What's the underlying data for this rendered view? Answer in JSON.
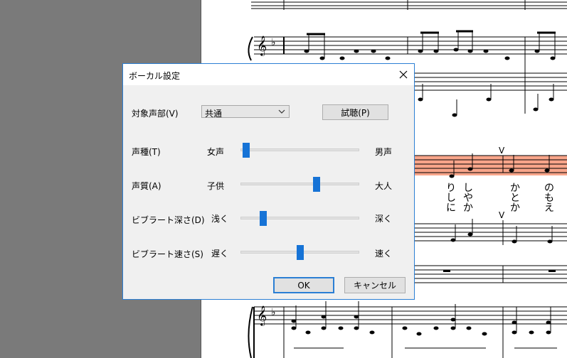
{
  "dialog": {
    "title": "ボーカル設定",
    "close_icon": "close-icon",
    "target_part": {
      "label": "対象声部(V)",
      "value": "共通"
    },
    "preview_button": "試聴(P)",
    "sliders": [
      {
        "label": "声種(T)",
        "min": "女声",
        "max": "男声",
        "value": 0.02
      },
      {
        "label": "声質(A)",
        "min": "子供",
        "max": "大人",
        "value": 0.65
      },
      {
        "label": "ビブラート深さ(D)",
        "min": "浅く",
        "max": "深く",
        "value": 0.17
      },
      {
        "label": "ビブラート速さ(S)",
        "min": "遅く",
        "max": "速く",
        "value": 0.5
      }
    ],
    "ok_button": "OK",
    "cancel_button": "キャンセル"
  },
  "score": {
    "lyrics": [
      "り",
      "し",
      "に",
      "し",
      "や",
      "か",
      "か",
      "と",
      "か",
      "の",
      "も",
      "え"
    ],
    "highlight_color": "#f8a58a"
  }
}
